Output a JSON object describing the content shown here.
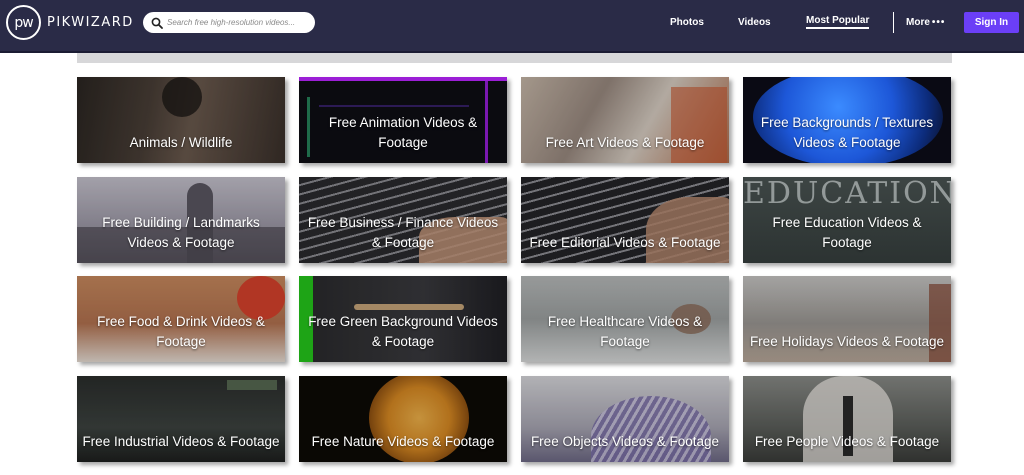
{
  "brand": {
    "logo_mark": "pw",
    "name": "PIKWIZARD"
  },
  "search": {
    "placeholder": "Search free high-resolution videos..."
  },
  "nav": {
    "photos": "Photos",
    "videos": "Videos",
    "most_popular": "Most Popular",
    "more": "More",
    "more_dots": "•••",
    "sign_in": "Sign In"
  },
  "categories": [
    {
      "label": "Animals / Wildlife",
      "icon": "animal-photo"
    },
    {
      "label": "Free Animation Videos & Footage",
      "icon": "animation-photo"
    },
    {
      "label": "Free Art Videos & Footage",
      "icon": "art-photo"
    },
    {
      "label": "Free Backgrounds / Textures Videos & Footage",
      "icon": "background-photo"
    },
    {
      "label": "Free Building / Landmarks Videos & Footage",
      "icon": "building-photo"
    },
    {
      "label": "Free Business / Finance Videos & Footage",
      "icon": "business-photo"
    },
    {
      "label": "Free Editorial Videos & Footage",
      "icon": "editorial-photo"
    },
    {
      "label": "Free Education Videos & Footage",
      "icon": "education-photo"
    },
    {
      "label": "Free Food & Drink Videos & Footage",
      "icon": "food-photo"
    },
    {
      "label": "Free Green Background Videos & Footage",
      "icon": "green-background-photo"
    },
    {
      "label": "Free Healthcare Videos & Footage",
      "icon": "healthcare-photo"
    },
    {
      "label": "Free Holidays Videos & Footage",
      "icon": "holidays-photo"
    },
    {
      "label": "Free Industrial Videos & Footage",
      "icon": "industrial-photo"
    },
    {
      "label": "Free Nature Videos & Footage",
      "icon": "nature-photo"
    },
    {
      "label": "Free Objects Videos & Footage",
      "icon": "objects-photo"
    },
    {
      "label": "Free People Videos & Footage",
      "icon": "people-photo"
    }
  ],
  "education_board_text": "EDUCATION",
  "colors": {
    "header_bg": "#2a2b47",
    "signin_bg": "#6b3ff7",
    "accent_purple": "#9b1fd6"
  }
}
